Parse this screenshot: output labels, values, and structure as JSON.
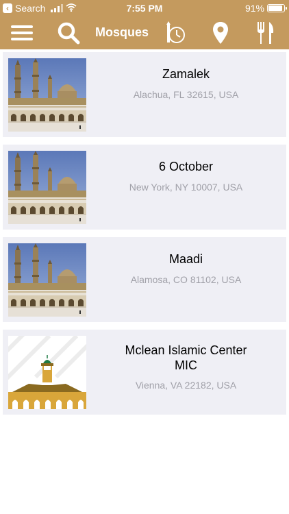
{
  "status": {
    "back_label": "Search",
    "time": "7:55 PM",
    "battery": "91%",
    "battery_level": 0.91
  },
  "nav": {
    "title": "Mosques",
    "icons": [
      "menu-icon",
      "search-icon",
      "prayer-clock-icon",
      "location-pin-icon",
      "restaurant-icon"
    ]
  },
  "colors": {
    "brand": "#c49a5e",
    "card_bg": "#efeff5",
    "address": "#a0a0a8"
  },
  "mosques": [
    {
      "name": "Zamalek",
      "address": "Alachua, FL 32615, USA",
      "image": "mosque-photo"
    },
    {
      "name": "6 October",
      "address": "New York, NY 10007, USA",
      "image": "mosque-photo"
    },
    {
      "name": "Maadi",
      "address": "Alamosa, CO 81102, USA",
      "image": "mosque-photo"
    },
    {
      "name": "Mclean Islamic Center MIC",
      "address": "Vienna, VA 22182, USA",
      "image": "mosque-logo"
    }
  ]
}
